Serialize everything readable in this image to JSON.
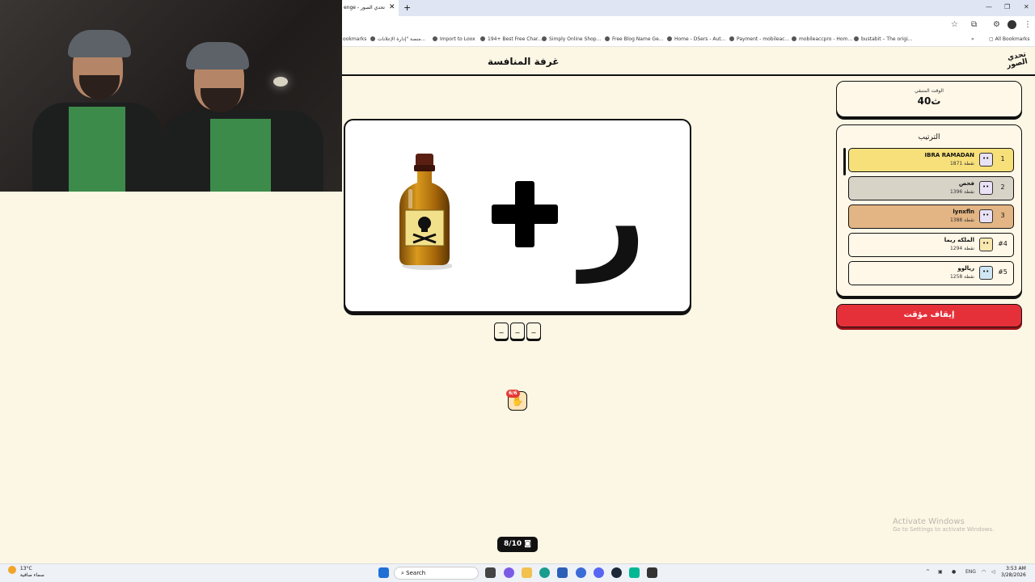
{
  "browser": {
    "tab_title": "enge - تحدي الصور",
    "tab_close": "✕",
    "new_tab": "+",
    "bookmarks": [
      "ookmarks",
      "منصة \"إدارة الإعلانات...",
      "Import to Loox",
      "194+ Best Free Char...",
      "Simply Online Shop...",
      "Free Blog Name Ge...",
      "Home - DSers - Aut...",
      "Payment - mobileac...",
      "mobileaccpro - Hom...",
      "bustabit – The origi..."
    ],
    "all_bookmarks": "All Bookmarks"
  },
  "page": {
    "title": "غرفة المنافسة",
    "logo_line1": "تحدي",
    "logo_line2": "الصور"
  },
  "puzzle": {
    "items": [
      "poison-bottle-icon",
      "plus-icon",
      "letter"
    ],
    "letter": "ر",
    "slots": [
      "_",
      "_",
      "_"
    ],
    "hint_badge": "6/6",
    "hint_icon": "✋",
    "counter": "8/10"
  },
  "timer": {
    "label": "الوقت المتبقي",
    "value": "40ث"
  },
  "ranking": {
    "title": "الترتيب",
    "rows": [
      {
        "position": "1",
        "name": "IBRA RAMADAN",
        "score": "1871 نقطة",
        "color": "#f7e07a"
      },
      {
        "position": "2",
        "name": "فحص",
        "score": "1396 نقطة",
        "color": "#d7d3c7"
      },
      {
        "position": "3",
        "name": "lynxfln",
        "score": "1388 نقطة",
        "color": "#e3b584"
      },
      {
        "position": "#4",
        "name": "الملكه ريما",
        "score": "1294 نقطة",
        "color": "#fff8e8"
      },
      {
        "position": "#5",
        "name": "ريالوو",
        "score": "1258 نقطة",
        "color": "#fff8e8"
      }
    ],
    "stop_button": "إيقاف مؤقت"
  },
  "watermark": {
    "title": "Activate Windows",
    "subtitle": "Go to Settings to activate Windows."
  },
  "taskbar": {
    "weather_temp": "13°C",
    "weather_desc": "سماء صافية",
    "search": "Search",
    "lang": "ENG",
    "time": "3:53 AM",
    "date": "3/28/2026"
  }
}
